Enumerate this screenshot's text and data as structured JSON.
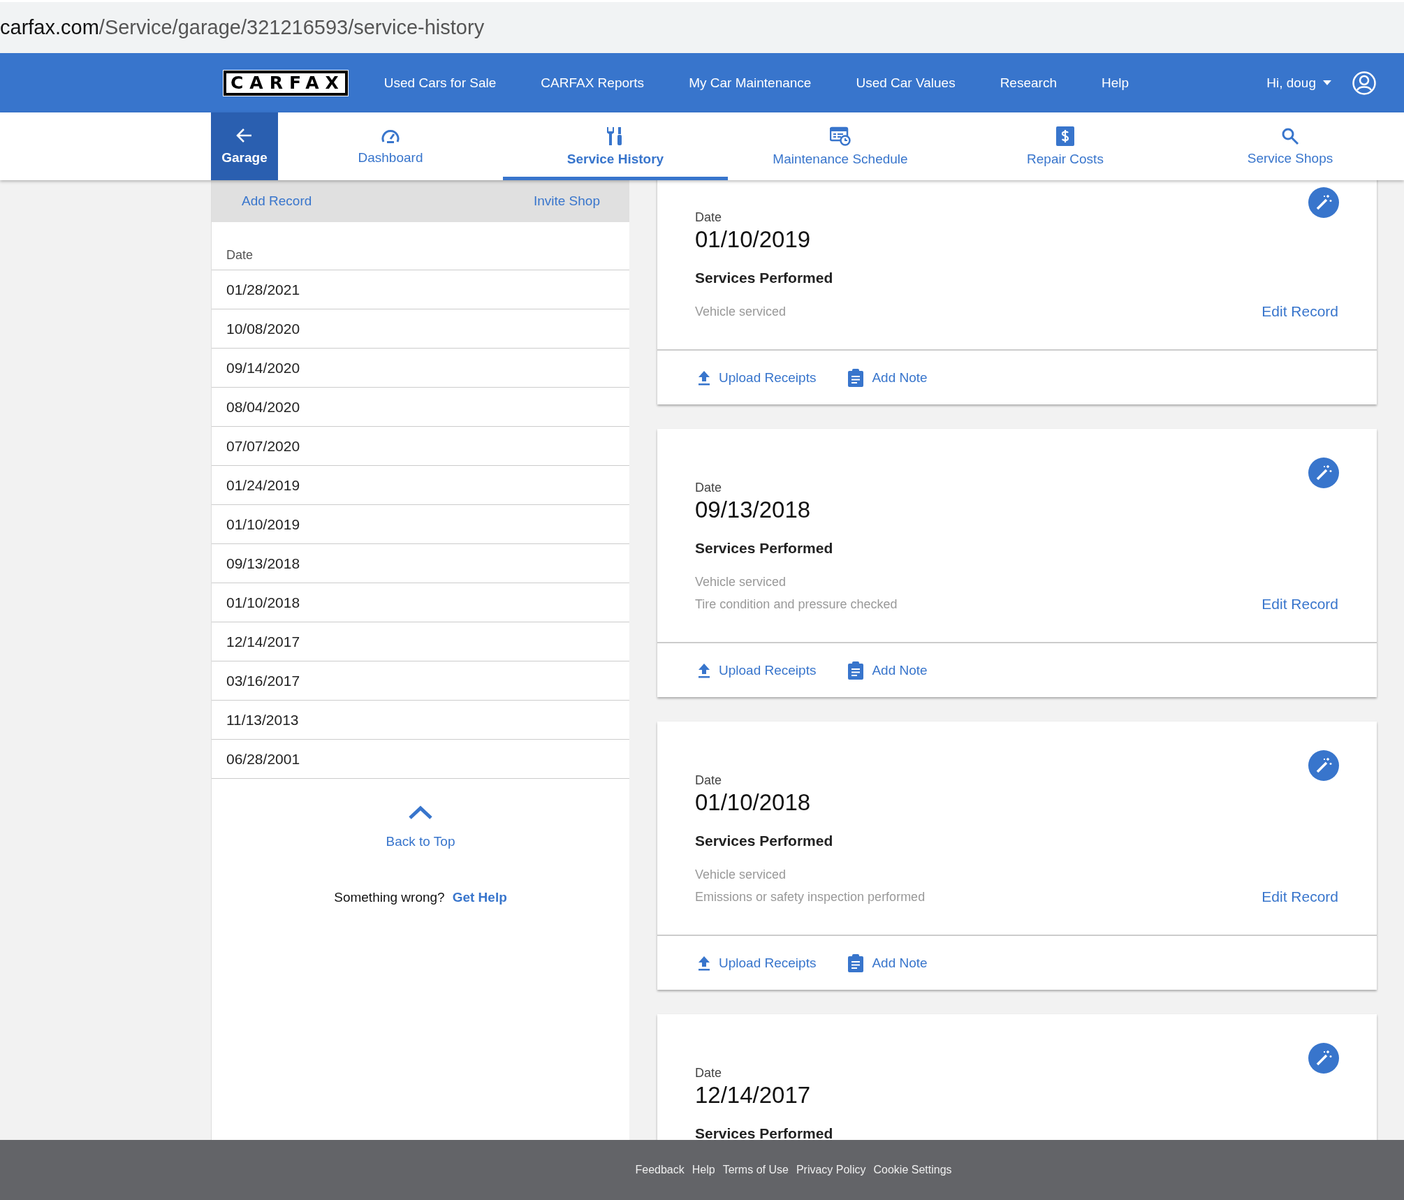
{
  "address_bar": {
    "domain": "carfax.com",
    "path": "/Service/garage/321216593/service-history"
  },
  "nav": {
    "logo": "CARFAX",
    "links": [
      "Used Cars for Sale",
      "CARFAX Reports",
      "My Car Maintenance",
      "Used Car Values",
      "Research",
      "Help"
    ],
    "user": "Hi, doug"
  },
  "back_button": {
    "label": "Garage"
  },
  "tabs": [
    {
      "label": "Dashboard",
      "kind": "gauge",
      "selected": false
    },
    {
      "label": "Service History",
      "kind": "tools",
      "selected": true
    },
    {
      "label": "Maintenance Schedule",
      "kind": "schedule",
      "selected": false
    },
    {
      "label": "Repair Costs",
      "kind": "dollar",
      "selected": false
    },
    {
      "label": "Service Shops",
      "kind": "search",
      "selected": false
    }
  ],
  "sidebar": {
    "actions": [
      "Add Record",
      "Invite Shop"
    ],
    "column": "Date",
    "dates": [
      "01/28/2021",
      "10/08/2020",
      "09/14/2020",
      "08/04/2020",
      "07/07/2020",
      "01/24/2019",
      "01/10/2019",
      "09/13/2018",
      "01/10/2018",
      "12/14/2017",
      "03/16/2017",
      "11/13/2013",
      "06/28/2001"
    ],
    "back_to_top": "Back to Top",
    "help_prompt": "Something wrong?",
    "help_link": "Get Help"
  },
  "records": [
    {
      "date_label": "Date",
      "date": "01/10/2019",
      "services_heading": "Services Performed",
      "services": [
        "Vehicle serviced"
      ],
      "edit_link": "Edit Record",
      "actions": [
        {
          "kind": "upload",
          "label": "Upload Receipts"
        },
        {
          "kind": "note",
          "label": "Add Note"
        }
      ]
    },
    {
      "date_label": "Date",
      "date": "09/13/2018",
      "services_heading": "Services Performed",
      "services": [
        "Vehicle serviced",
        "Tire condition and pressure checked"
      ],
      "edit_link": "Edit Record",
      "actions": [
        {
          "kind": "upload",
          "label": "Upload Receipts"
        },
        {
          "kind": "note",
          "label": "Add Note"
        }
      ]
    },
    {
      "date_label": "Date",
      "date": "01/10/2018",
      "services_heading": "Services Performed",
      "services": [
        "Vehicle serviced",
        "Emissions or safety inspection performed"
      ],
      "edit_link": "Edit Record",
      "actions": [
        {
          "kind": "upload",
          "label": "Upload Receipts"
        },
        {
          "kind": "note",
          "label": "Add Note"
        }
      ]
    },
    {
      "date_label": "Date",
      "date": "12/14/2017",
      "services_heading": "Services Performed"
    }
  ],
  "footer": [
    "Feedback",
    "Help",
    "Terms of Use",
    "Privacy Policy",
    "Cookie Settings"
  ]
}
